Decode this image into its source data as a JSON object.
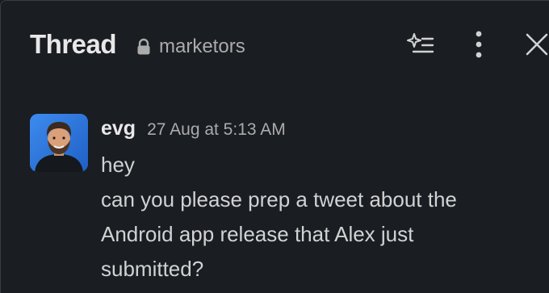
{
  "header": {
    "title": "Thread",
    "channel": "marketors",
    "icons": [
      "lock-icon",
      "ai-summary-icon",
      "more-options-icon",
      "close-icon"
    ]
  },
  "message": {
    "author": "evg",
    "timestamp": "27 Aug at 5:13 AM",
    "lines": [
      "hey",
      "can you please prep a tweet about the",
      "Android app release that Alex just",
      "submitted?"
    ]
  },
  "colors": {
    "background": "#1a1d21",
    "text": "#d1d2d3",
    "muted": "#ababad",
    "avatar_bg": "#2b6fd6"
  }
}
